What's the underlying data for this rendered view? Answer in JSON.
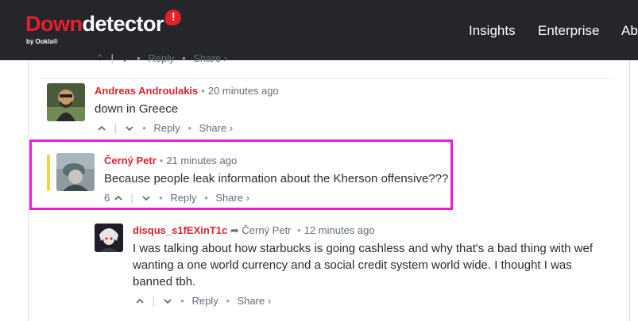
{
  "header": {
    "logo_down": "Down",
    "logo_detector": "detector",
    "logo_sub": "by Ookla®",
    "nav": [
      "Insights",
      "Enterprise",
      "Abo"
    ]
  },
  "partial_prev": {
    "reply": "Reply",
    "share": "Share ›"
  },
  "comments": [
    {
      "author": "Andreas Androulakis",
      "time": "20 minutes ago",
      "text": "down in Greece",
      "votes": "",
      "reply": "Reply",
      "share": "Share ›"
    },
    {
      "author": "Černý Petr",
      "time": "21 minutes ago",
      "text": "Because people leak information about the Kherson offensive???",
      "votes": "6",
      "reply": "Reply",
      "share": "Share ›"
    },
    {
      "author": "disqus_s1fEXinT1c",
      "in_reply_to": "Černý Petr",
      "time": "12 minutes ago",
      "text": "I was talking about how starbucks is going cashless and why that's a bad thing with wef wanting a one world currency and a social credit system world wide. I thought I was banned tbh.",
      "votes": "",
      "reply": "Reply",
      "share": "Share ›"
    }
  ],
  "colors": {
    "header_bg": "#25262b",
    "brand_red": "#e8202a",
    "author_red": "#d9232d",
    "highlight_magenta": "#ee1ad6",
    "unread_yellow": "#f5d04a"
  },
  "icons": [
    "upvote-icon",
    "downvote-icon",
    "reply-arrow-icon"
  ]
}
